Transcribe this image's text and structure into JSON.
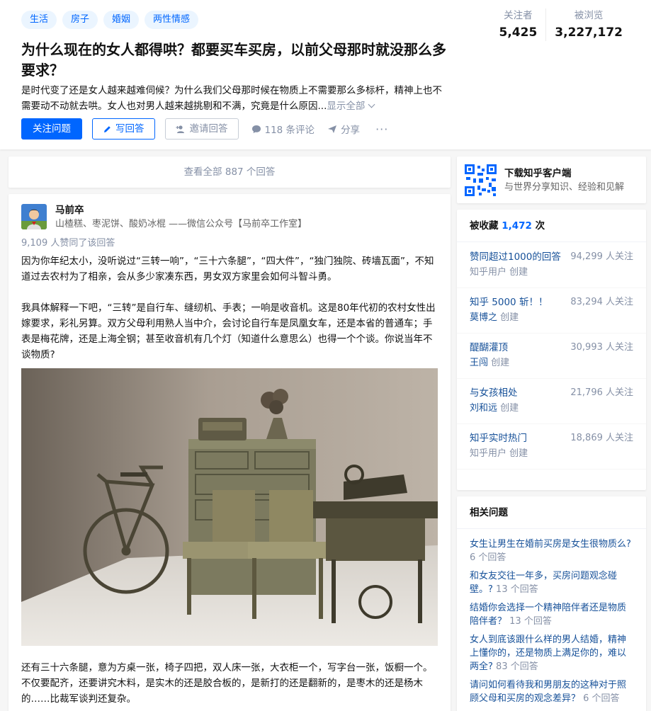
{
  "question": {
    "topics": [
      "生活",
      "房子",
      "婚姻",
      "两性情感"
    ],
    "title": "为什么现在的女人都得哄？都要买车买房，以前父母那时就没那么多要求？",
    "detail": "是时代变了还是女人越来越难伺候？为什么我们父母那时候在物质上不需要那么多标杆，精神上也不需要动不动就去哄。女人也对男人越来越挑剔和不满，究竟是什么原因...",
    "show_all": "显示全部",
    "follow_btn": "关注问题",
    "answer_btn": "写回答",
    "invite_btn": "邀请回答",
    "comments": "118 条评论",
    "share": "分享",
    "more": "···",
    "followers_label": "关注者",
    "followers": "5,425",
    "views_label": "被浏览",
    "views": "3,227,172"
  },
  "view_all_answers": "查看全部 887 个回答",
  "answer": {
    "author_name": "马前卒",
    "author_bio": "山楂糕、枣泥饼、酸奶冰棍 ——微信公众号【马前卒工作室】",
    "vote_info": "9,109 人赞同了该回答",
    "para1": "因为你年纪太小，没听说过“三转一响”，“三十六条腿”，“四大件”，“独门独院、砖墙瓦面”，不知道过去农村为了相亲，会从多少家凑东西，男女双方家里会如何斗智斗勇。",
    "para2": "我具体解释一下吧，“三转”是自行车、缝纫机、手表；一响是收音机。这是80年代初的农村女性出嫁要求，彩礼另算。双方父母利用熟人当中介，会讨论自行车是凤凰女车，还是本省的普通车；手表是梅花牌，还是上海全钢；甚至收音机有几个灯（知道什么意思么）也得一个个谈。你说当年不谈物质?",
    "para3": "还有三十六条腿，意为方桌一张，椅子四把，双人床一张，大衣柜一个，写字台一张，饭橱一个。不仅要配齐，还要讲究木料，是实木的还是胶合板的，是新打的还是翻新的，是枣木的还是杨木的……比裁军谈判还复杂。"
  },
  "sidebar": {
    "download_title": "下载知乎客户端",
    "download_sub": "与世界分享知识、经验和见解",
    "collect_prefix": "被收藏",
    "collect_count": "1,472",
    "collect_suffix": "次",
    "collections": [
      {
        "title": "赞同超过1000的回答",
        "creator": "知乎用户",
        "created": "创建",
        "follow": "94,299 人关注"
      },
      {
        "title": "知乎 5000 斩！！",
        "creator": "莫博之",
        "created": "创建",
        "follow": "83,294 人关注"
      },
      {
        "title": "醍醐灌顶",
        "creator": "王闯",
        "created": "创建",
        "follow": "30,993 人关注"
      },
      {
        "title": "与女孩相处",
        "creator": "刘和远",
        "created": "创建",
        "follow": "21,796 人关注"
      },
      {
        "title": "知乎实时热门",
        "creator": "知乎用户",
        "created": "创建",
        "follow": "18,869 人关注"
      }
    ],
    "related_title": "相关问题",
    "related": [
      {
        "q": "女生让男生在婚前买房是女生很物质么?",
        "c": "6 个回答"
      },
      {
        "q": "和女友交往一年多，买房问题观念碰壁。?",
        "c": "13 个回答"
      },
      {
        "q": "结婚你会选择一个精神陪伴者还是物质陪伴者？",
        "c": "13 个回答"
      },
      {
        "q": "女人到底该跟什么样的男人结婚，精神上懂你的，还是物质上满足你的，难以两全?",
        "c": "83 个回答"
      },
      {
        "q": "请问如何看待我和男朋友的这种对于照顾父母和买房的观念差异？",
        "c": "6 个回答"
      }
    ]
  },
  "colors": {
    "brand": "#0066ff",
    "link": "#175199",
    "muted": "#8590a6"
  }
}
